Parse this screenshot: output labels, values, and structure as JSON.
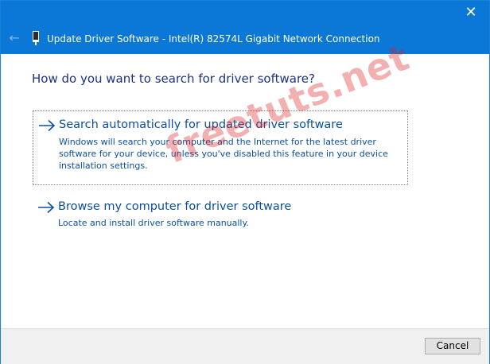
{
  "window": {
    "title": "Update Driver Software - Intel(R) 82574L Gigabit Network Connection",
    "close_glyph": "✕",
    "back_glyph": "←"
  },
  "content": {
    "heading": "How do you want to search for driver software?",
    "options": [
      {
        "icon": "arrow-right-icon",
        "title": "Search automatically for updated driver software",
        "description": "Windows will search your computer and the Internet for the latest driver software for your device, unless you've disabled this feature in your device installation settings."
      },
      {
        "icon": "arrow-right-icon",
        "title": "Browse my computer for driver software",
        "description": "Locate and install driver software manually."
      }
    ]
  },
  "footer": {
    "cancel_label": "Cancel"
  },
  "watermark": {
    "text": "freetuts.net"
  },
  "colors": {
    "titlebar": "#0b78d7",
    "heading": "#1e3287",
    "link": "#0a4f9d",
    "watermark": "#dc1e1e"
  }
}
